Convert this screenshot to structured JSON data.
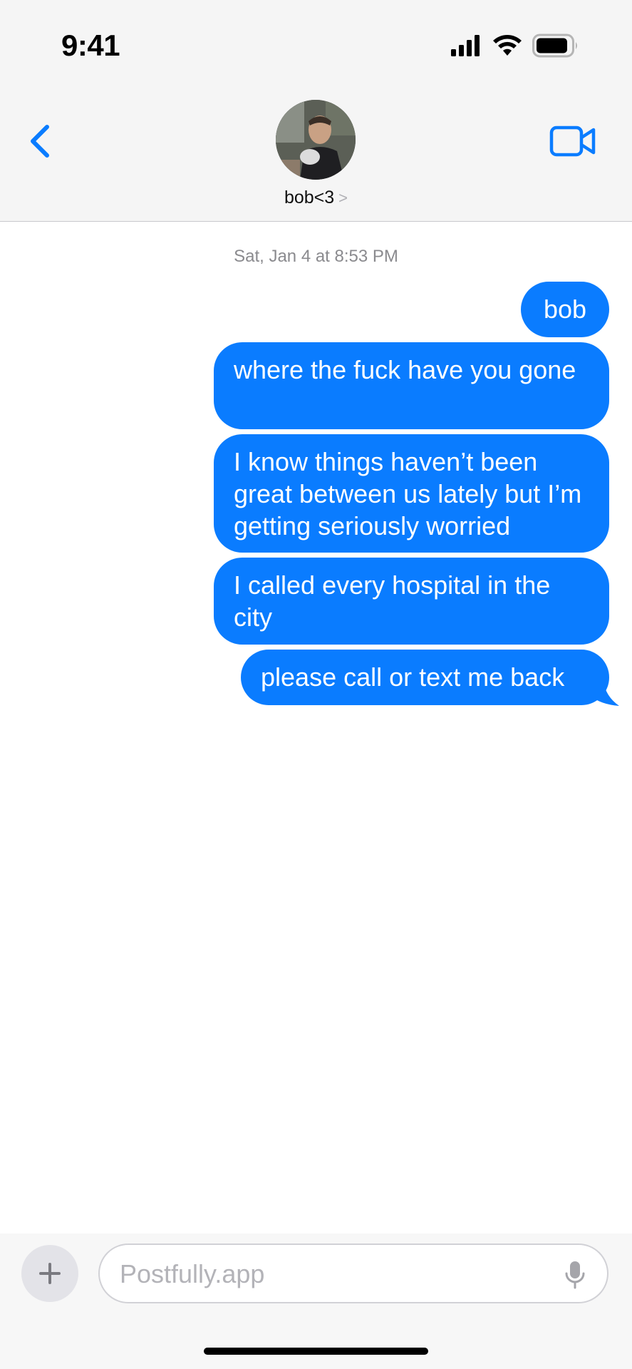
{
  "status_bar": {
    "time": "9:41"
  },
  "header": {
    "contact_name": "bob<3",
    "chevron": ">"
  },
  "conversation": {
    "timestamp": "Sat, Jan 4 at 8:53 PM",
    "messages": [
      {
        "text": "bob",
        "direction": "outgoing"
      },
      {
        "text": "where the fuck have you gone",
        "direction": "outgoing"
      },
      {
        "text": "I know things haven’t been great between us lately but I’m getting seriously worried",
        "direction": "outgoing"
      },
      {
        "text": "I called every hospital in the city",
        "direction": "outgoing"
      },
      {
        "text": "please call or text me back",
        "direction": "outgoing"
      }
    ]
  },
  "composer": {
    "placeholder": "Postfully.app",
    "plus_label": "+"
  },
  "colors": {
    "accent": "#0a7cff",
    "bubble_outgoing": "#0a7cff",
    "header_bg": "#f5f5f5",
    "timestamp_text": "#8a8a8e"
  },
  "icons": [
    "back-chevron-icon",
    "video-call-icon",
    "signal-icon",
    "wifi-icon",
    "battery-icon",
    "plus-icon",
    "microphone-icon"
  ]
}
